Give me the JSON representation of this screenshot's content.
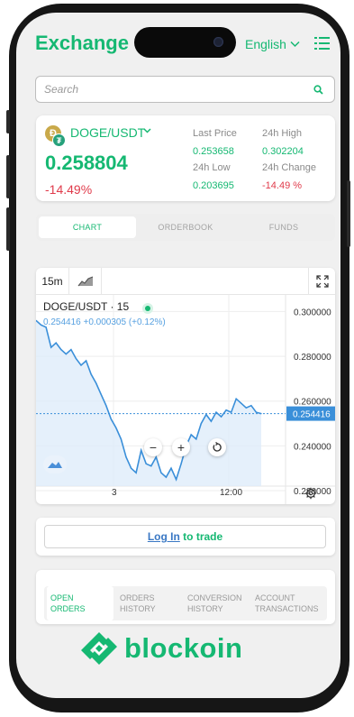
{
  "header": {
    "title": "Exchange",
    "language": "English"
  },
  "search": {
    "placeholder": "Search"
  },
  "ticker": {
    "pair": "DOGE/USDT",
    "price": "0.258804",
    "change": "-14.49%",
    "stats": {
      "last_price_label": "Last Price",
      "last_price": "0.253658",
      "high_label": "24h High",
      "high": "0.302204",
      "low_label": "24h Low",
      "low": "0.203695",
      "change_label": "24h Change",
      "change": "-14.49 %"
    }
  },
  "tabs": [
    "CHART",
    "ORDERBOOK",
    "FUNDS"
  ],
  "chart": {
    "timeframe": "15m",
    "symbol": "DOGE/USDT · 15",
    "ohlc": "0.254416  +0.000305 (+0.12%)",
    "current_price_label": "0.254416",
    "x_labels": [
      "3",
      "12:00"
    ]
  },
  "chart_data": {
    "type": "area",
    "title": "DOGE/USDT · 15",
    "xlabel": "",
    "ylabel": "",
    "x_tick_labels": [
      "3",
      "12:00"
    ],
    "y_ticks": [
      0.22,
      0.24,
      0.26,
      0.28,
      0.3
    ],
    "y_tick_labels": [
      "0.220000",
      "0.240000",
      "0.260000",
      "0.280000",
      "0.300000"
    ],
    "ylim": [
      0.218,
      0.305
    ],
    "current_value": 0.254416,
    "grid": true,
    "series": [
      {
        "values": [
          0.296,
          0.294,
          0.293,
          0.284,
          0.286,
          0.283,
          0.281,
          0.283,
          0.279,
          0.276,
          0.278,
          0.272,
          0.268,
          0.263,
          0.258,
          0.252,
          0.248,
          0.243,
          0.235,
          0.23,
          0.228,
          0.238,
          0.232,
          0.231,
          0.235,
          0.228,
          0.226,
          0.23,
          0.225,
          0.232,
          0.24,
          0.245,
          0.243,
          0.25,
          0.254,
          0.251,
          0.255,
          0.253,
          0.256,
          0.255,
          0.261,
          0.259,
          0.257,
          0.258,
          0.255,
          0.2544
        ],
        "color": "#3a8fd9"
      }
    ]
  },
  "login": {
    "link": "Log In",
    "suffix": " to trade"
  },
  "order_tabs": [
    {
      "line1": "OPEN",
      "line2": "ORDERS"
    },
    {
      "line1": "ORDERS",
      "line2": "HISTORY"
    },
    {
      "line1": "CONVERSION",
      "line2": "HISTORY"
    },
    {
      "line1": "ACCOUNT",
      "line2": "TRANSACTIONS"
    }
  ],
  "brand": {
    "name": "blockoin"
  },
  "colors": {
    "accent": "#15b872",
    "negative": "#e03b4b",
    "chart_line": "#3a8fd9",
    "link": "#3a78c4"
  }
}
